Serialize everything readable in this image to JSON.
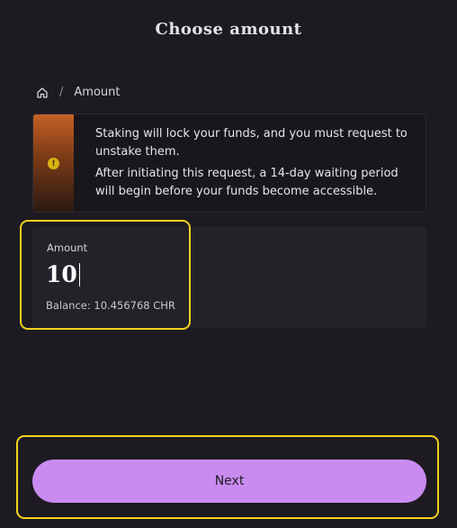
{
  "header": {
    "title": "Choose amount"
  },
  "breadcrumb": {
    "home_icon": "home-icon",
    "separator": "/",
    "current": "Amount"
  },
  "warning": {
    "icon": "info-icon",
    "icon_glyph": "!",
    "line1": "Staking will lock your funds, and you must request to unstake them.",
    "line2": "After initiating this request, a 14-day waiting period will begin before your funds become accessible."
  },
  "amount": {
    "label": "Amount",
    "value": "10",
    "balance": "Balance: 10.456768 CHR"
  },
  "actions": {
    "next_label": "Next"
  },
  "colors": {
    "accent": "#c98bf0",
    "highlight": "#f2d21c",
    "background": "#1d1b21",
    "warning_stripe": "#c56026"
  }
}
